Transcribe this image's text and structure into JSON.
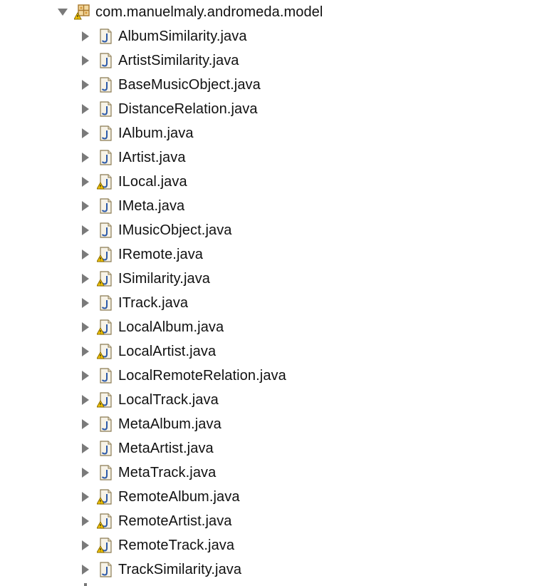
{
  "package": {
    "name": "com.manuelmaly.andromeda.model",
    "expanded": true,
    "icon": "package-warning-icon"
  },
  "files": [
    {
      "label": "AlbumSimilarity.java",
      "warning": false
    },
    {
      "label": "ArtistSimilarity.java",
      "warning": false
    },
    {
      "label": "BaseMusicObject.java",
      "warning": false
    },
    {
      "label": "DistanceRelation.java",
      "warning": false
    },
    {
      "label": "IAlbum.java",
      "warning": false
    },
    {
      "label": "IArtist.java",
      "warning": false
    },
    {
      "label": "ILocal.java",
      "warning": true
    },
    {
      "label": "IMeta.java",
      "warning": false
    },
    {
      "label": "IMusicObject.java",
      "warning": false
    },
    {
      "label": "IRemote.java",
      "warning": true
    },
    {
      "label": "ISimilarity.java",
      "warning": true
    },
    {
      "label": "ITrack.java",
      "warning": false
    },
    {
      "label": "LocalAlbum.java",
      "warning": true
    },
    {
      "label": "LocalArtist.java",
      "warning": true
    },
    {
      "label": "LocalRemoteRelation.java",
      "warning": false
    },
    {
      "label": "LocalTrack.java",
      "warning": true
    },
    {
      "label": "MetaAlbum.java",
      "warning": false
    },
    {
      "label": "MetaArtist.java",
      "warning": false
    },
    {
      "label": "MetaTrack.java",
      "warning": false
    },
    {
      "label": "RemoteAlbum.java",
      "warning": true
    },
    {
      "label": "RemoteArtist.java",
      "warning": true
    },
    {
      "label": "RemoteTrack.java",
      "warning": true
    },
    {
      "label": "TrackSimilarity.java",
      "warning": false
    }
  ],
  "colors": {
    "twisty": "#7a7a7a",
    "java_icon_border": "#8a7a52",
    "java_icon_fill": "#f7f3e8",
    "java_letter": "#2d5aa8",
    "warning": "#f2c200"
  }
}
